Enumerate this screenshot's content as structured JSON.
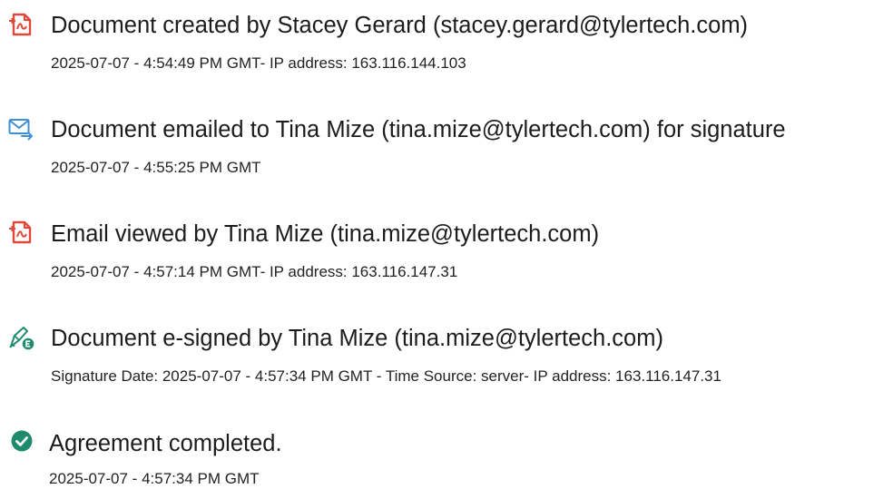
{
  "colors": {
    "pdf_icon": "#e0493a",
    "email_icon": "#3d8fd6",
    "signature_icon": "#1f8a6e",
    "completed_icon": "#1f8a6e",
    "text": "#1c1c1c"
  },
  "events": [
    {
      "icon": "pdf-document-icon",
      "title": "Document created by Stacey Gerard (stacey.gerard@tylertech.com)",
      "detail": "2025-07-07 - 4:54:49 PM GMT- IP address: 163.116.144.103"
    },
    {
      "icon": "email-sent-icon",
      "title": "Document emailed to Tina Mize (tina.mize@tylertech.com) for signature",
      "detail": "2025-07-07 - 4:55:25 PM GMT"
    },
    {
      "icon": "pdf-document-icon",
      "title": "Email viewed by Tina Mize (tina.mize@tylertech.com)",
      "detail": "2025-07-07 - 4:57:14 PM GMT- IP address: 163.116.147.31"
    },
    {
      "icon": "e-signature-icon",
      "title": "Document e-signed by Tina Mize (tina.mize@tylertech.com)",
      "detail": "Signature Date: 2025-07-07 - 4:57:34 PM GMT - Time Source: server- IP address: 163.116.147.31"
    },
    {
      "icon": "checkmark-icon",
      "title": "Agreement completed.",
      "detail": "2025-07-07 - 4:57:34 PM GMT"
    }
  ]
}
